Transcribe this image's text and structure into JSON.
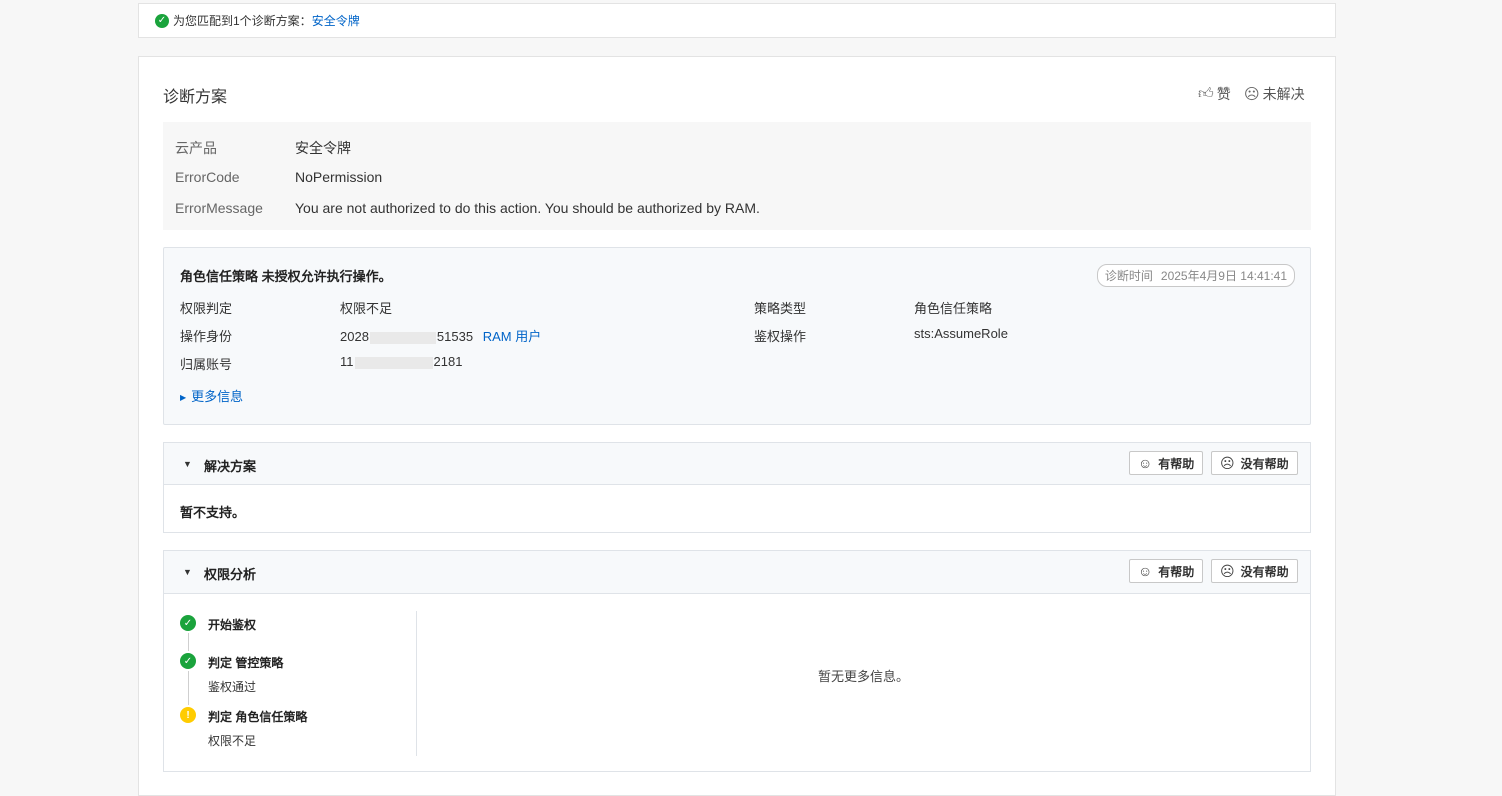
{
  "banner": {
    "text": "为您匹配到1个诊断方案：",
    "link": "安全令牌"
  },
  "panel": {
    "title": "诊断方案",
    "like_label": "赞",
    "unresolved_label": "未解决"
  },
  "error_info": {
    "rows": [
      {
        "label": "云产品",
        "value": "安全令牌"
      },
      {
        "label": "ErrorCode",
        "value": "NoPermission"
      },
      {
        "label": "ErrorMessage",
        "value": "You are not authorized to do this action. You should be authorized by RAM."
      }
    ]
  },
  "diagnosis": {
    "title": "角色信任策略 未授权允许执行操作。",
    "time_label": "诊断时间",
    "time_value": "2025年4月9日 14:41:41",
    "perm_label": "权限判定",
    "perm_value": "权限不足",
    "identity_label": "操作身份",
    "identity_prefix": "2028",
    "identity_suffix": "51535",
    "identity_type": "RAM 用户",
    "account_label": "归属账号",
    "account_prefix": "11",
    "account_suffix": "2181",
    "policy_type_label": "策略类型",
    "policy_type_value": "角色信任策略",
    "auth_action_label": "鉴权操作",
    "auth_action_value": "sts:AssumeRole",
    "more_label": "更多信息"
  },
  "solution": {
    "title": "解决方案",
    "helpful": "有帮助",
    "not_helpful": "没有帮助",
    "content": "暂不支持。"
  },
  "analysis": {
    "title": "权限分析",
    "helpful": "有帮助",
    "not_helpful": "没有帮助",
    "steps": [
      {
        "title": "开始鉴权",
        "status": "ok",
        "sub": ""
      },
      {
        "title": "判定 管控策略",
        "status": "ok",
        "sub": "鉴权通过"
      },
      {
        "title": "判定 角色信任策略",
        "status": "warn",
        "sub": "权限不足"
      }
    ],
    "empty_text": "暂无更多信息。"
  },
  "colors": {
    "link": "#0064c8",
    "success": "#1aa33c",
    "warning": "#ffcc00"
  }
}
